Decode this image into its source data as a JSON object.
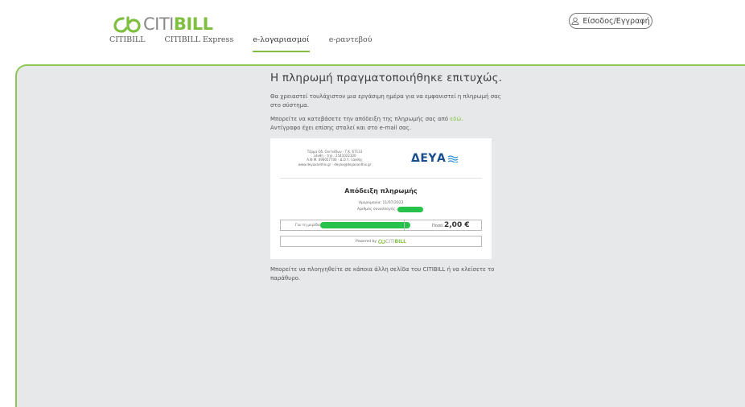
{
  "header": {
    "logo": {
      "thin": "CITI",
      "bold": "BILL"
    },
    "nav": [
      {
        "label": "CITIBILL"
      },
      {
        "label": "CITIBILL Express"
      },
      {
        "label": "e-λογαριασμοί"
      },
      {
        "label": "e-ραντεβού"
      }
    ],
    "active_nav": "e-λογαριασμοί",
    "login_label": "Είσοδος/Εγγραφή",
    "accent_color": "#7fbf3f"
  },
  "main": {
    "title": "Η πληρωμή πραγματοποιήθηκε επιτυχώς.",
    "info_text": "Θα χρειαστεί τουλάχιστον μια εργάσιμη ημέρα για να εμφανιστεί η πληρωμή σας στο σύστημα.",
    "download_text_before": "Μπορείτε να κατεβάσετε την απόδειξη της πληρωμής σας από ",
    "download_link": "εδώ.",
    "email_text": "Αντίγραφο έχει επίσης σταλεί και στο e-mail σας.",
    "after_text": "Μπορείτε να πλοηγηθείτε σε κάποια άλλη σελίδα του CITIBILL ή να κλείσετε το παράθυρο."
  },
  "receipt": {
    "address_lines": [
      "Τέρμα Οδ. Οιντιάδων - Τ.Κ. 67133",
      "Ξάνθη - τηλ.: 2541022100",
      "Α.Φ.Μ. 096057700 - Δ.Ο.Υ. Ξάνθης",
      "www.deyaxanthis.gr - deyax@deyaxanthis.gr"
    ],
    "provider_logo": "ΔΕΥΑ",
    "title": "Απόδειξη πληρωμής",
    "date_label": "Ημερομηνία: 11/07/2022",
    "transaction_label": "Αριθμός συναλλαγής:",
    "amount_label": "Για τη μερίδα",
    "amount_key": "Ποσό:",
    "amount_value": "2,00 €",
    "powered_by": "Powered by",
    "redaction_color": "#27c24c"
  }
}
